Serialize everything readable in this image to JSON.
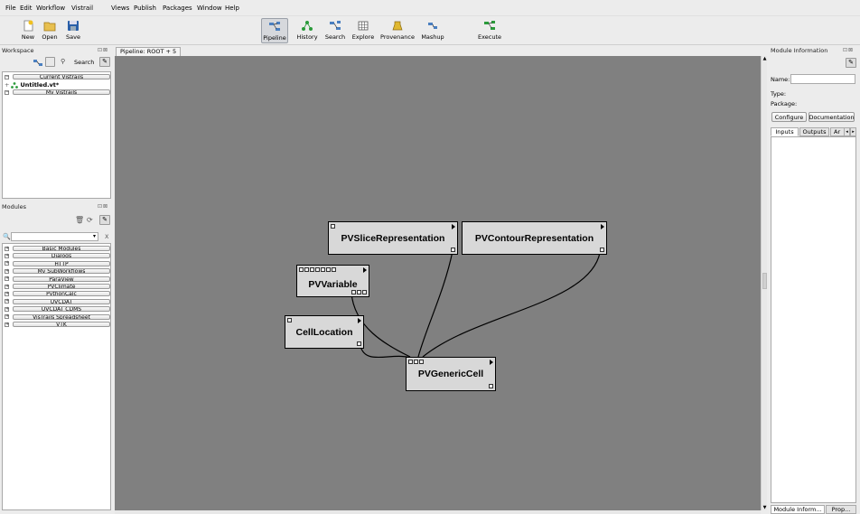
{
  "menubar": {
    "items": [
      "File",
      "Edit",
      "Workflow",
      "Vistrail",
      "Views",
      "Publish",
      "Packages",
      "Window",
      "Help"
    ]
  },
  "toolbar": {
    "left": [
      {
        "label": "New",
        "icon": "new-file-icon"
      },
      {
        "label": "Open",
        "icon": "open-folder-icon"
      },
      {
        "label": "Save",
        "icon": "save-disk-icon"
      }
    ],
    "views": [
      {
        "label": "Pipeline",
        "icon": "pipeline-icon",
        "active": true
      },
      {
        "label": "History",
        "icon": "history-icon"
      },
      {
        "label": "Search",
        "icon": "search-icon"
      },
      {
        "label": "Explore",
        "icon": "explore-icon"
      },
      {
        "label": "Provenance",
        "icon": "provenance-icon"
      },
      {
        "label": "Mashup",
        "icon": "mashup-icon"
      }
    ],
    "execute": {
      "label": "Execute",
      "icon": "execute-icon"
    }
  },
  "workspace": {
    "title": "Workspace",
    "search_label": "Search",
    "groups": [
      {
        "label": "Current Vistrails",
        "expanded": true
      },
      {
        "label": "My Vistrails",
        "expanded": true
      }
    ],
    "current_item": "Untitled.vt*"
  },
  "modules_panel": {
    "title": "Modules",
    "search_placeholder": "",
    "clear": "X",
    "packages": [
      "Basic Modules",
      "Dialogs",
      "HTTP",
      "My SubWorkflows",
      "ParaView",
      "PVClimate",
      "PythonCalc",
      "UVCDAT",
      "UVCDAT CDMS",
      "VisTrails Spreadsheet",
      "VTK"
    ]
  },
  "pipeline_tab": {
    "label": "Pipeline: ROOT + 5"
  },
  "pipeline": {
    "modules": [
      {
        "name": "PVSliceRepresentation"
      },
      {
        "name": "PVContourRepresentation"
      },
      {
        "name": "PVVariable"
      },
      {
        "name": "CellLocation"
      },
      {
        "name": "PVGenericCell"
      }
    ]
  },
  "module_info": {
    "title": "Module Information",
    "name_label": "Name:",
    "name_value": "",
    "type_label": "Type:",
    "package_label": "Package:",
    "configure": "Configure",
    "documentation": "Documentation",
    "tabs": [
      "Inputs",
      "Outputs",
      "Ar"
    ],
    "bottom_tabs": [
      "Module Inform...",
      "Prop..."
    ]
  },
  "colors": {
    "canvas": "#808080",
    "module_fill": "#d8d8d8",
    "chrome": "#ececec"
  }
}
